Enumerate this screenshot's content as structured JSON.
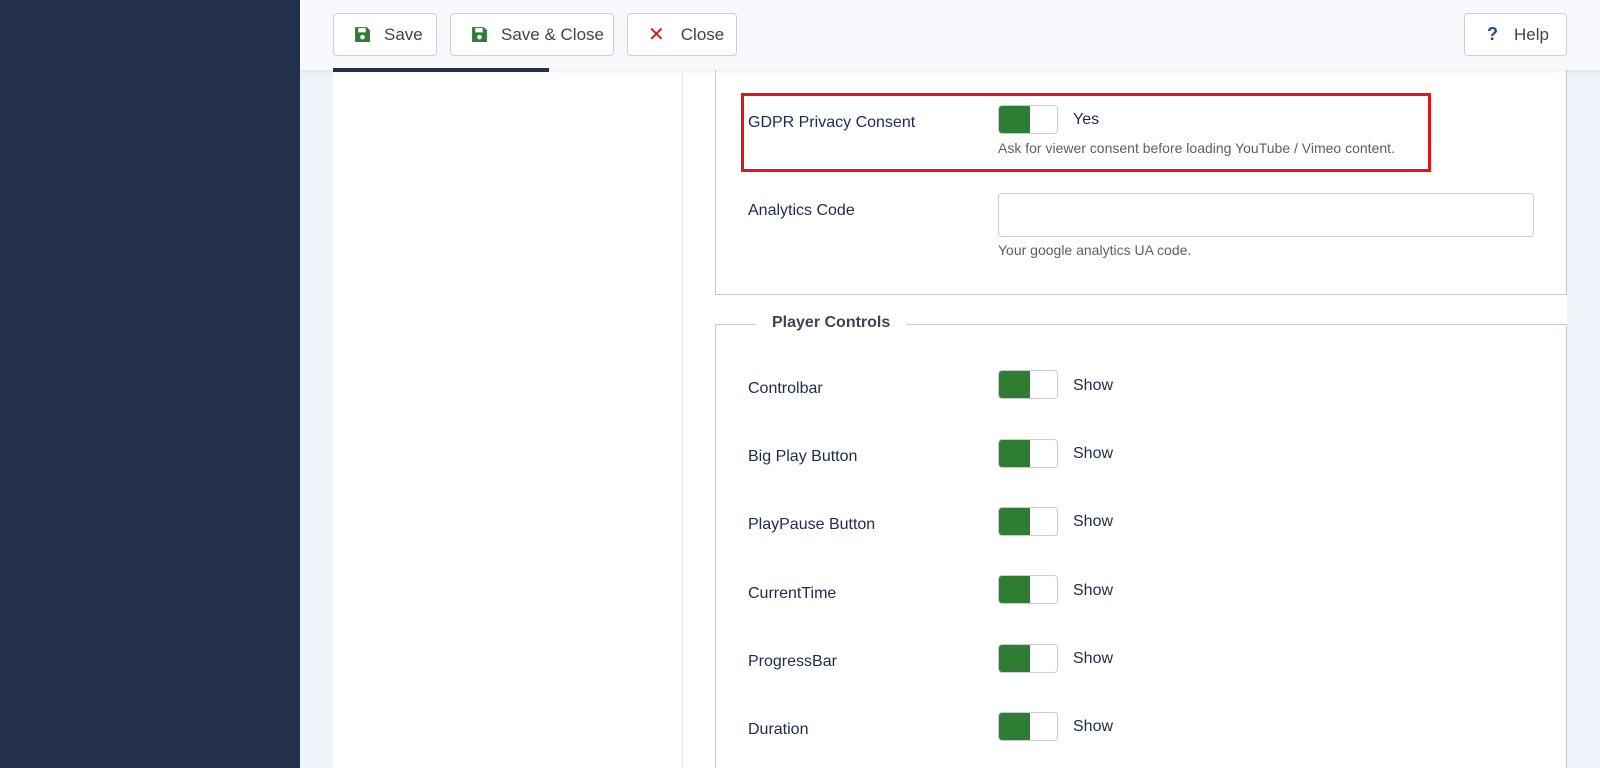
{
  "toolbar": {
    "save_label": "Save",
    "save_close_label": "Save & Close",
    "close_label": "Close",
    "help_label": "Help"
  },
  "icons": {
    "help_glyph": "?",
    "close_glyph": "✕"
  },
  "colors": {
    "sidebar": "#22304a",
    "toggle_on": "#2e7d32",
    "highlight": "#e3131b"
  },
  "gdpr": {
    "label": "GDPR Privacy Consent",
    "value": "Yes",
    "description": "Ask for viewer consent before loading YouTube / Vimeo content."
  },
  "analytics": {
    "label": "Analytics Code",
    "value": "",
    "description": "Your google analytics UA code."
  },
  "player_controls": {
    "legend": "Player Controls",
    "items": [
      {
        "label": "Controlbar",
        "value": "Show"
      },
      {
        "label": "Big Play Button",
        "value": "Show"
      },
      {
        "label": "PlayPause Button",
        "value": "Show"
      },
      {
        "label": "CurrentTime",
        "value": "Show"
      },
      {
        "label": "ProgressBar",
        "value": "Show"
      },
      {
        "label": "Duration",
        "value": "Show"
      }
    ]
  }
}
